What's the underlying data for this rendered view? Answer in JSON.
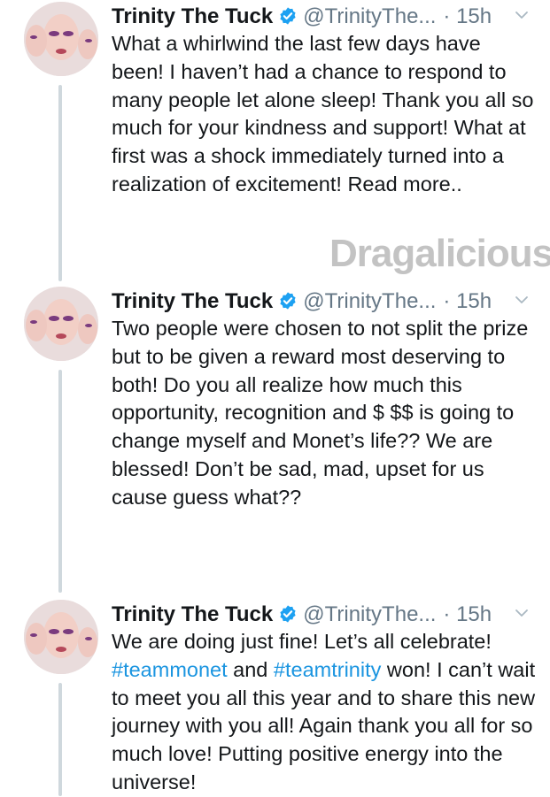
{
  "tweets": [
    {
      "author_name": "Trinity The Tuck",
      "handle": "@TrinityThe...",
      "time": "· 15h",
      "text_parts": [
        {
          "type": "text",
          "value": "What a whirlwind the last few days have been! I haven’t had a chance to respond to many people let alone sleep! Thank you all so much for your kindness and support! What at first was a shock immediately turned into a realization of excitement! Read more.."
        }
      ]
    },
    {
      "author_name": "Trinity The Tuck",
      "handle": "@TrinityThe...",
      "time": "· 15h",
      "text_parts": [
        {
          "type": "text",
          "value": "Two people were chosen to not split the prize but to be given a reward most deserving to both! Do you all realize how much this opportunity, recognition and $ $$ is going to change myself and Monet’s life?? We are blessed! Don’t be sad, mad, upset for us cause guess what??"
        }
      ]
    },
    {
      "author_name": "Trinity The Tuck",
      "handle": "@TrinityThe...",
      "time": "· 15h",
      "text_parts": [
        {
          "type": "text",
          "value": "We are doing just fine! Let’s all celebrate! "
        },
        {
          "type": "hashtag",
          "value": "#teammonet"
        },
        {
          "type": "text",
          "value": " and "
        },
        {
          "type": "hashtag",
          "value": "#teamtrinity"
        },
        {
          "type": "text",
          "value": " won! I can’t wait to meet you all this year and to share this new journey with you all! Again thank you all for so much love! Putting positive energy into the universe!"
        }
      ]
    }
  ],
  "watermark": "Dragalicious",
  "colors": {
    "text": "#14171a",
    "secondary": "#657786",
    "link": "#1b95e0",
    "verified": "#1da1f2",
    "thread_line": "#cfd8dd"
  },
  "icons": {
    "verified": "verified-badge-icon",
    "caret": "chevron-down-icon"
  }
}
